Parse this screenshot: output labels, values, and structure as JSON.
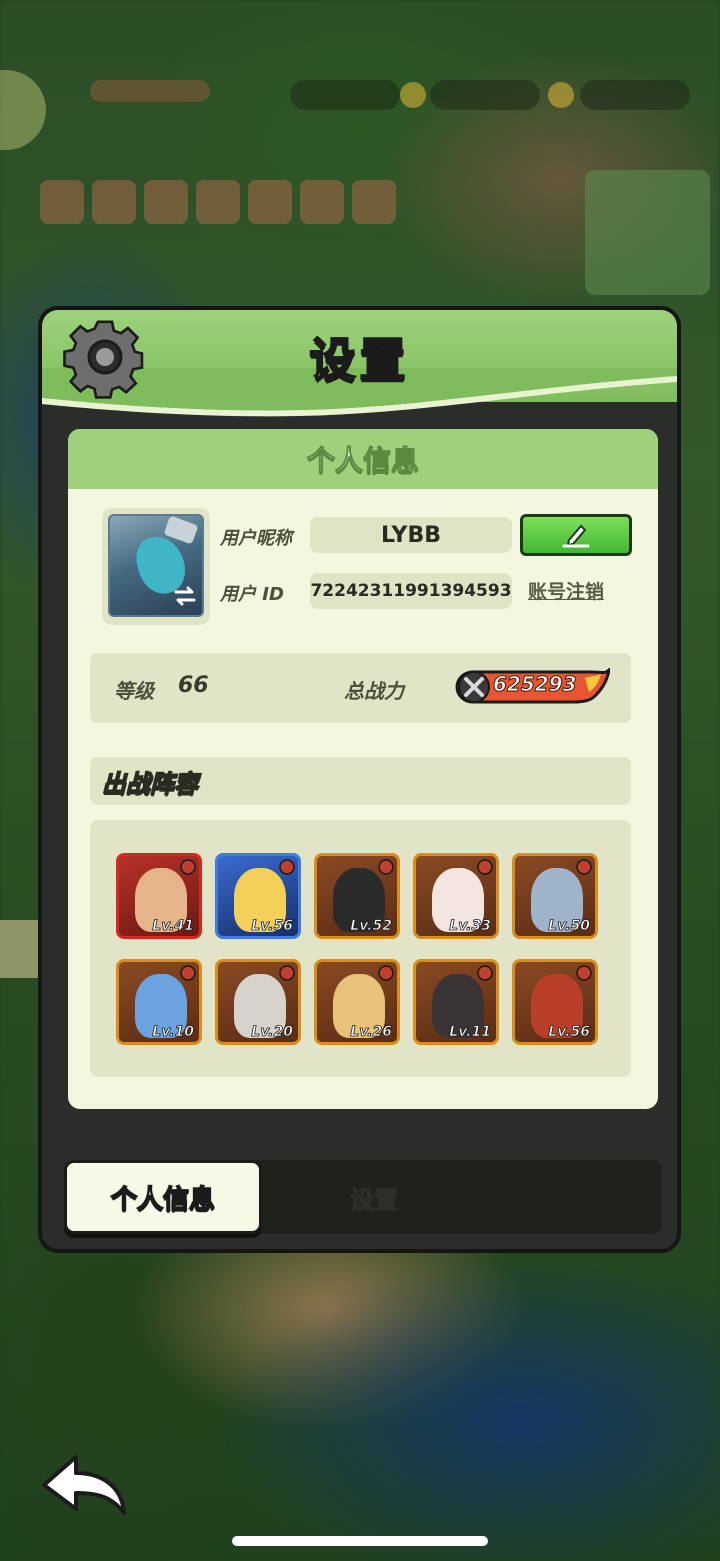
{
  "dialog": {
    "title": "设置"
  },
  "profile": {
    "section_title": "个人信息",
    "nickname_label": "用户昵称",
    "nickname_value": "LYBB",
    "id_label": "用户 ID",
    "id_value": "72242311991394593",
    "logout_label": "账号注销"
  },
  "stats": {
    "level_label": "等级",
    "level_value": "66",
    "power_label": "总战力",
    "power_value": "625293"
  },
  "lineup": {
    "title": "出战阵容",
    "heroes": [
      {
        "level": "Lv.41",
        "frame": "red",
        "color": "#e6b48a"
      },
      {
        "level": "Lv.56",
        "frame": "blue",
        "color": "#f2d05a"
      },
      {
        "level": "Lv.52",
        "frame": "gold",
        "color": "#2a2a2a"
      },
      {
        "level": "Lv.33",
        "frame": "gold",
        "color": "#f3e6e0"
      },
      {
        "level": "Lv.50",
        "frame": "gold",
        "color": "#9fb4c8"
      },
      {
        "level": "Lv.10",
        "frame": "gold",
        "color": "#6ba3e0"
      },
      {
        "level": "Lv.20",
        "frame": "gold",
        "color": "#d6d2cc"
      },
      {
        "level": "Lv.26",
        "frame": "gold",
        "color": "#e8c27a"
      },
      {
        "level": "Lv.11",
        "frame": "gold",
        "color": "#3a3434"
      },
      {
        "level": "Lv.56",
        "frame": "gold",
        "color": "#b8402a"
      }
    ]
  },
  "tabs": {
    "active_label": "个人信息",
    "inactive_label": "设置"
  },
  "colors": {
    "accent_green": "#7ee05a",
    "header_green": "#9cd27b",
    "card_bg": "#f4f7e0"
  }
}
